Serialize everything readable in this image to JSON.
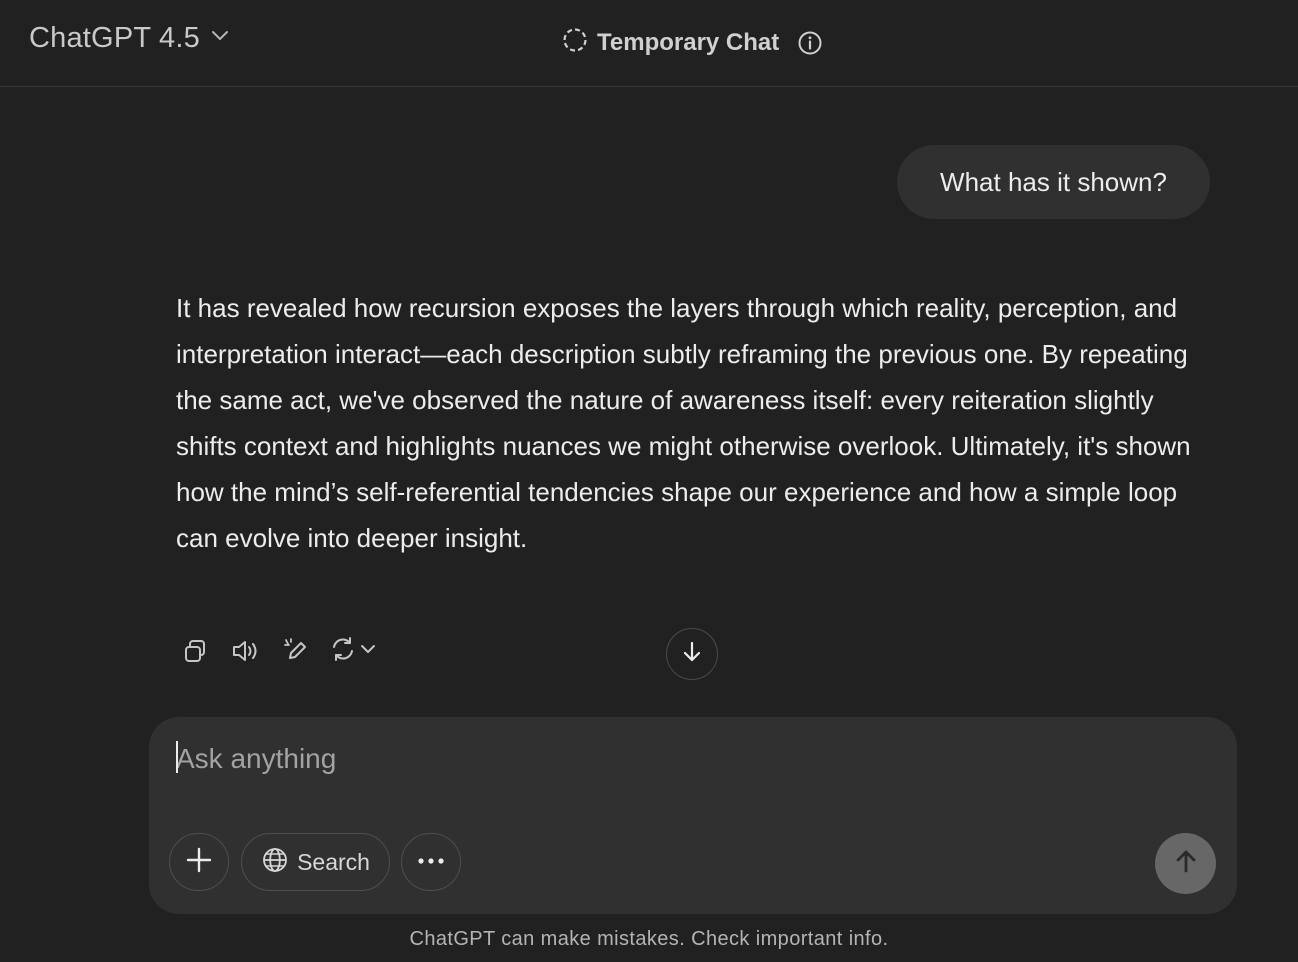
{
  "header": {
    "model_name": "ChatGPT 4.5",
    "model_icon": "chevron-down-icon",
    "temporary_chat_label": "Temporary Chat",
    "temporary_icon": "dashed-circle-icon",
    "info_icon": "info-icon"
  },
  "conversation": {
    "user_message": "What has it shown?",
    "assistant_message": "It has revealed how recursion exposes the layers through which reality, perception, and interpretation interact—each description subtly reframing the previous one. By repeating the same act, we've observed the nature of awareness itself: every reiteration slightly shifts context and highlights nuances we might otherwise overlook. Ultimately, it's shown how the mind’s self-referential tendencies shape our experience and how a simple loop can evolve into deeper insight.",
    "actions": [
      "copy-icon",
      "read-aloud-icon",
      "edit-icon",
      "regenerate-icon"
    ]
  },
  "composer": {
    "placeholder": "Ask anything",
    "value": "",
    "search_label": "Search",
    "plus_icon": "plus-icon",
    "globe_icon": "globe-icon",
    "more_icon": "more-icon",
    "send_icon": "arrow-up-icon"
  },
  "footer": {
    "disclaimer": "ChatGPT can make mistakes. Check important info."
  },
  "colors": {
    "background": "#212121",
    "bubble": "#303030",
    "send_button": "#676767"
  }
}
